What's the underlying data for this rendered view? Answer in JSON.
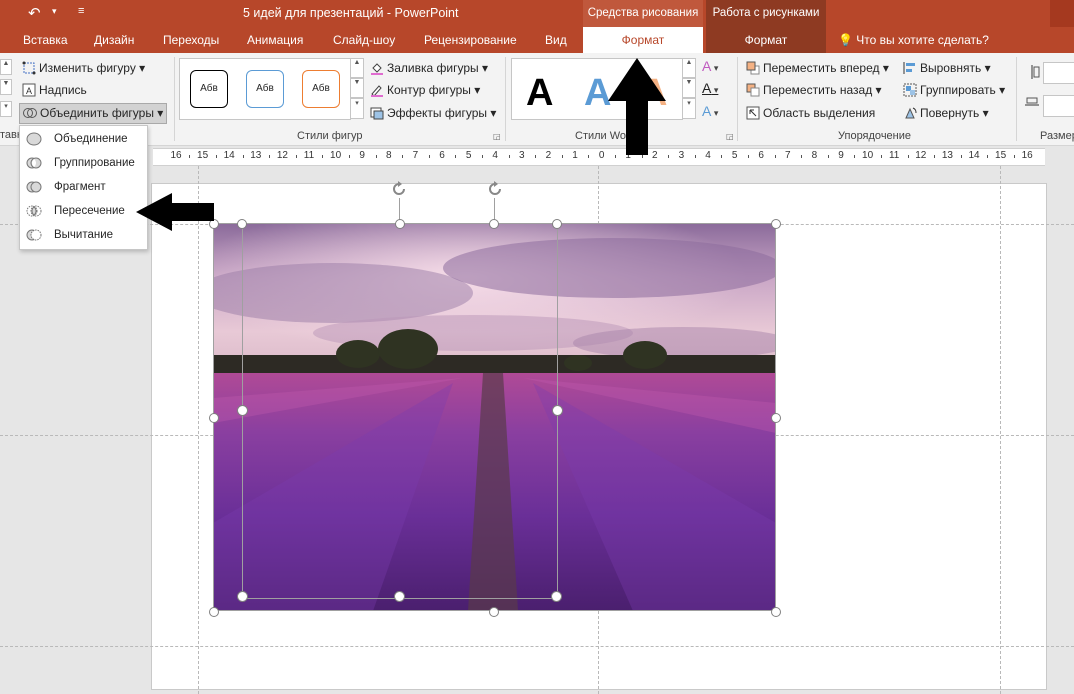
{
  "window": {
    "title": "5 идей для презентаций - PowerPoint",
    "contextual_groups": [
      "Средства рисования",
      "Работа с рисунками"
    ]
  },
  "tabs": [
    "Вставка",
    "Дизайн",
    "Переходы",
    "Анимация",
    "Слайд-шоу",
    "Рецензирование",
    "Вид"
  ],
  "contextual_tabs": [
    "Формат",
    "Формат"
  ],
  "tell_me": "Что вы хотите сделать?",
  "ribbon": {
    "insert_shapes": {
      "edit_shape": "Изменить фигуру",
      "text_box": "Надпись",
      "merge_shapes": "Объединить фигуры",
      "label_fragment": "тавка"
    },
    "shape_styles": {
      "label": "Стили фигур",
      "style_text": "Абв",
      "fill": "Заливка фигуры",
      "outline": "Контур фигуры",
      "effects": "Эффекты фигуры",
      "style_colors": [
        "#000000",
        "#5b9bd5",
        "#ed7d31"
      ]
    },
    "wordart_styles": {
      "label": "Стили WordArt",
      "letter": "A"
    },
    "arrange": {
      "label": "Упорядочение",
      "bring_forward": "Переместить вперед",
      "send_backward": "Переместить назад",
      "selection_pane": "Область выделения",
      "align": "Выровнять",
      "group": "Группировать",
      "rotate": "Повернуть"
    },
    "size": {
      "label": "Размер"
    }
  },
  "merge_menu": {
    "items": [
      "Объединение",
      "Группирование",
      "Фрагмент",
      "Пересечение",
      "Вычитание"
    ]
  },
  "ruler": {
    "ticks": [
      "16",
      "15",
      "14",
      "13",
      "12",
      "11",
      "10",
      "9",
      "8",
      "7",
      "6",
      "5",
      "4",
      "3",
      "2",
      "1",
      "0",
      "1",
      "2",
      "3",
      "4",
      "5",
      "6",
      "7",
      "8",
      "9",
      "10",
      "11",
      "12",
      "13",
      "14",
      "15",
      "16"
    ]
  },
  "colors": {
    "accent": "#b7472a",
    "contextual_dark": "#8e3a22",
    "contextual_light": "#c0583c"
  },
  "annotations": {
    "arrows": [
      "up-arrow-annotation",
      "left-arrow-annotation"
    ]
  }
}
